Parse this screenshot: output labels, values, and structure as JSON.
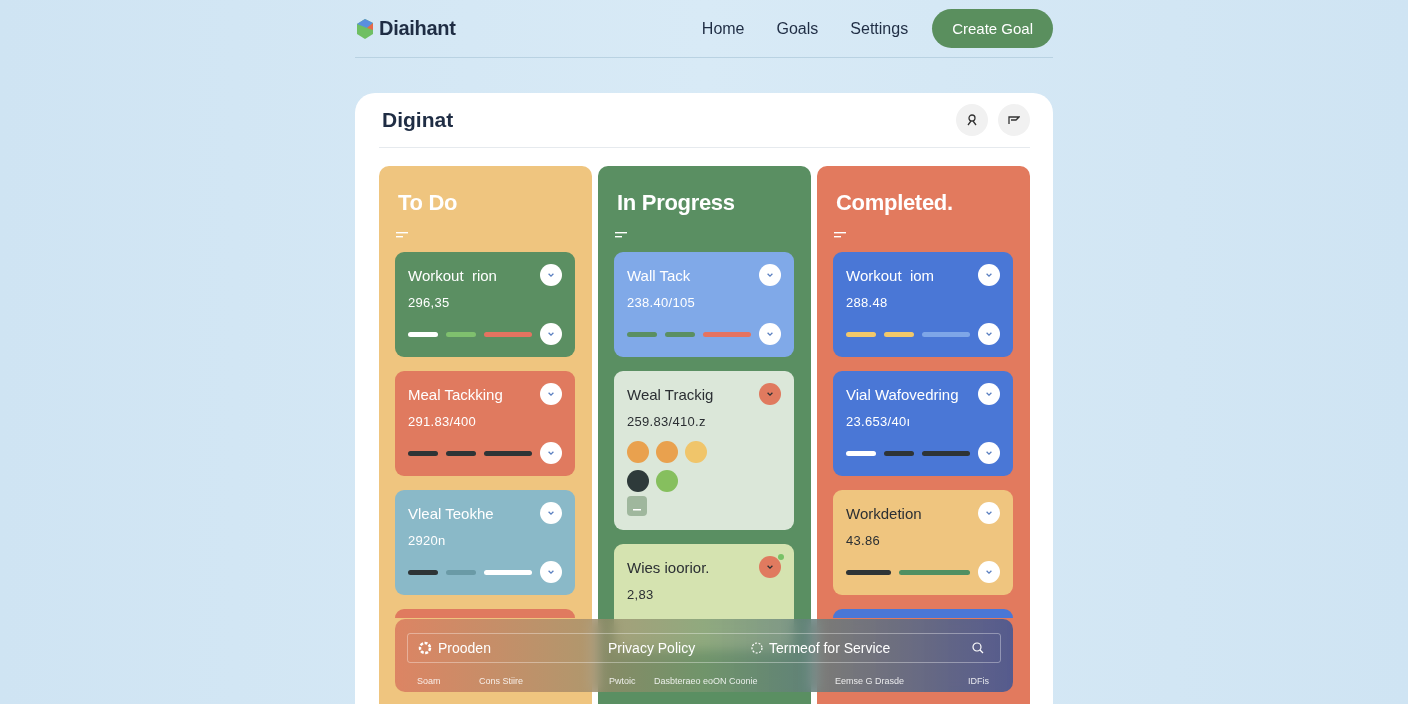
{
  "header": {
    "logo": "Diaihant",
    "nav": [
      {
        "label": "Home"
      },
      {
        "label": "Goals"
      },
      {
        "label": "Settings"
      }
    ],
    "action": "Create Goal"
  },
  "board": {
    "title": "Diginat",
    "columns": [
      {
        "title": "To Do",
        "color": "#efc57f",
        "cards": [
          {
            "kind": "bars",
            "title": "Workout  rion",
            "value": "296,35",
            "color": "#5b8f62",
            "highlighted": false,
            "segments": [
              {
                "color": "#ffffff"
              },
              {
                "color": "#7fc06e"
              },
              {
                "color": "#e57360"
              }
            ]
          },
          {
            "kind": "bars",
            "title": "Meal Tackking",
            "value": "291.83/400",
            "color": "#e07a5f",
            "highlighted": false,
            "segments": [
              {
                "color": "#2e3436"
              },
              {
                "color": "#2e3436"
              },
              {
                "color": "#2e3436"
              }
            ]
          },
          {
            "kind": "bars",
            "title": "Vleal Teokhe",
            "value": "2920n",
            "color": "#8ab9c8",
            "highlighted": false,
            "segments": [
              {
                "color": "#2e3436"
              },
              {
                "color": "#6a9aa6"
              },
              {
                "color": "#ffffff"
              }
            ]
          },
          {
            "kind": "partial",
            "color": "#e07a5f"
          }
        ]
      },
      {
        "title": "In Progress",
        "color": "#5a8f62",
        "cards": [
          {
            "kind": "bars",
            "title": "Wall Tack",
            "value": "238.40/105",
            "color": "#80a9e8",
            "highlighted": false,
            "segments": [
              {
                "color": "#5a8f62"
              },
              {
                "color": "#5a8f62"
              },
              {
                "color": "#e57360"
              }
            ]
          },
          {
            "kind": "tokens",
            "title": "Weal Trackig",
            "value": "259.83/410.z",
            "color": "#dbe7d9",
            "highlighted": true,
            "tokens": [
              {
                "color": "#e9a14e"
              },
              {
                "color": "#e9a14e"
              },
              {
                "color": "#f0c56a"
              },
              {
                "color": "#2e3a3a"
              },
              {
                "color": "#86bf5e"
              }
            ]
          },
          {
            "kind": "plain",
            "title": "Wies ioorior.",
            "value": "2,83",
            "color": "#d5e3b0",
            "highlighted": true,
            "dot": true
          }
        ]
      },
      {
        "title": "Completed.",
        "color": "#e27a5e",
        "cards": [
          {
            "kind": "bars",
            "title": "Workout  iom",
            "value": "288.48",
            "color": "#4a77d6",
            "highlighted": false,
            "segments": [
              {
                "color": "#f2c86a"
              },
              {
                "color": "#f2c86a"
              },
              {
                "color": "#7ea6e8"
              }
            ]
          },
          {
            "kind": "bars",
            "title": "Vial Wafovedring",
            "value": "23.653/40ı",
            "color": "#4a77d6",
            "highlighted": false,
            "segments": [
              {
                "color": "#ffffff"
              },
              {
                "color": "#2e3436"
              },
              {
                "color": "#2e3436"
              }
            ]
          },
          {
            "kind": "bars",
            "title": "Workdetion",
            "value": "43.86",
            "color": "#efc57f",
            "highlighted": false,
            "segments": [
              {
                "color": "#2e3436"
              },
              {
                "color": "#4f8f62"
              }
            ]
          },
          {
            "kind": "partial",
            "color": "#4a77d6"
          }
        ]
      }
    ]
  },
  "footer": {
    "links": [
      {
        "label": "Prooden"
      },
      {
        "label": "Privacy Policy"
      },
      {
        "label": "Termeof for Service"
      }
    ],
    "sub": [
      "Soam",
      "Cons Stiire",
      "Pwtoic",
      "Dasbteraeo eoON Coonie",
      "Eemse G Drasde",
      "IDFis"
    ]
  }
}
